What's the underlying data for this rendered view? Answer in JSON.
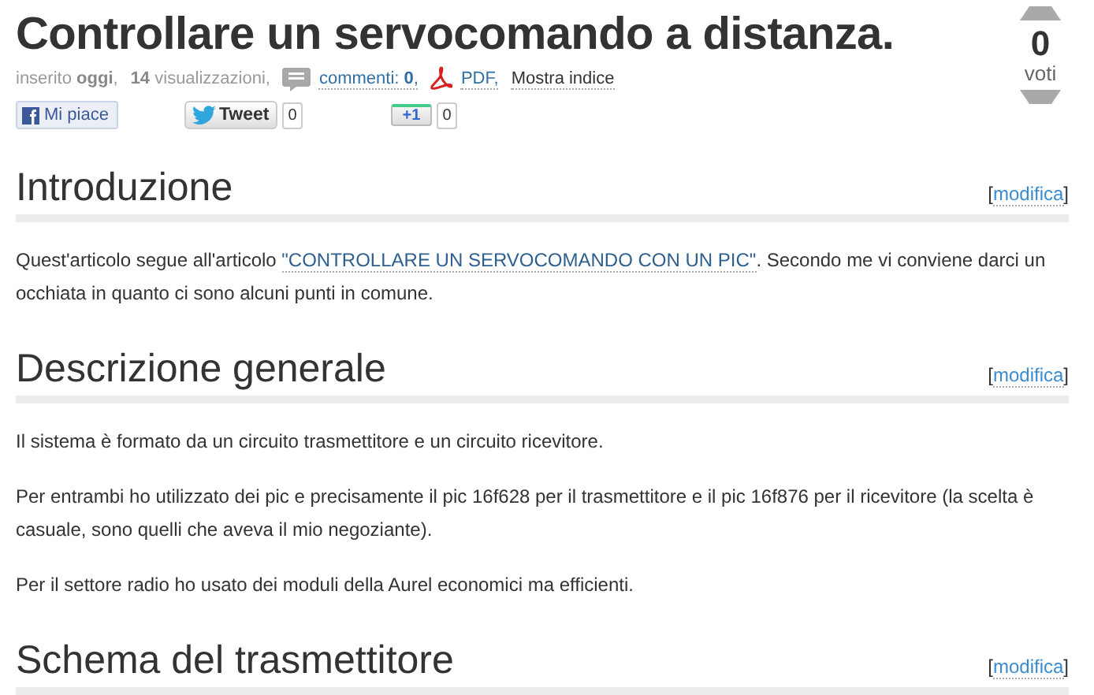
{
  "title": "Controllare un servocomando a distanza.",
  "votes": {
    "count": "0",
    "label": "voti"
  },
  "meta": [
    {
      "kind": "text",
      "text": "inserito **oggi**,"
    },
    {
      "kind": "text",
      "text": "**14** visualizzazioni,"
    },
    {
      "kind": "comments",
      "text": "commenti: **0**,"
    },
    {
      "kind": "pdf",
      "text": "PDF,"
    },
    {
      "kind": "link",
      "text": "Mostra indice"
    }
  ],
  "social": {
    "like": "Mi piace",
    "tweet": "Tweet",
    "tweet_count": "0",
    "plusone": "+1",
    "plusone_count": "0"
  },
  "sections": [
    {
      "heading": "Introduzione",
      "bracket_open": "[",
      "edit_link": "modifica",
      "bracket_close": "]",
      "paragraphs": [
        {
          "parts": [
            {
              "kind": "text",
              "text": "Quest'articolo segue all'articolo "
            },
            {
              "kind": "link",
              "text": "\"CONTROLLARE UN SERVOCOMANDO CON UN PIC\""
            },
            {
              "kind": "text",
              "text": ". Secondo me vi conviene darci un occhiata in quanto ci sono alcuni punti in comune."
            }
          ]
        }
      ]
    },
    {
      "heading": "Descrizione generale",
      "bracket_open": "[",
      "edit_link": "modifica",
      "bracket_close": "]",
      "paragraphs": [
        {
          "parts": [
            {
              "kind": "text",
              "text": "Il sistema è formato da un circuito trasmettitore e un circuito ricevitore."
            }
          ]
        },
        {
          "parts": [
            {
              "kind": "text",
              "text": "Per entrambi ho utilizzato dei pic e precisamente il pic 16f628 per il trasmettitore e il pic 16f876 per il ricevitore (la scelta è casuale, sono quelli che aveva il mio negoziante)."
            }
          ]
        },
        {
          "parts": [
            {
              "kind": "text",
              "text": "Per il settore radio ho usato dei moduli della Aurel economici ma efficienti."
            }
          ]
        }
      ]
    },
    {
      "heading": "Schema del trasmettitore",
      "bracket_open": "[",
      "edit_link": "modifica",
      "bracket_close": "]"
    }
  ]
}
